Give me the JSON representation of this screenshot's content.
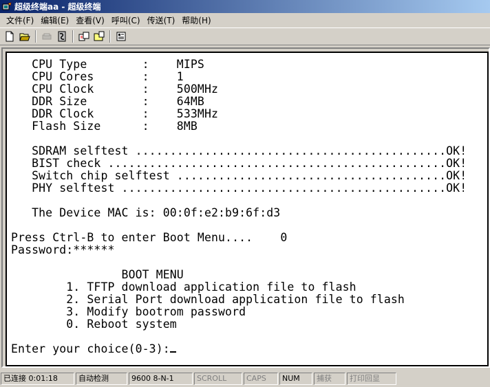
{
  "window": {
    "title": "超级终端aa - 超级终端"
  },
  "menubar": {
    "items": [
      "文件(F)",
      "编辑(E)",
      "查看(V)",
      "呼叫(C)",
      "传送(T)",
      "帮助(H)"
    ]
  },
  "toolbar": {
    "icons": [
      "new-icon",
      "open-icon",
      "disconnect-icon",
      "dial-icon",
      "send-icon",
      "receive-icon",
      "properties-icon"
    ]
  },
  "terminal": {
    "lines": [
      "   CPU Type        :    MIPS",
      "   CPU Cores       :    1",
      "   CPU Clock       :    500MHz",
      "   DDR Size        :    64MB",
      "   DDR Clock       :    533MHz",
      "   Flash Size      :    8MB",
      "",
      "   SDRAM selftest .............................................OK!",
      "   BIST check .................................................OK!",
      "   Switch chip selftest .......................................OK!",
      "   PHY selftest ...............................................OK!",
      "",
      "   The Device MAC is: 00:0f:e2:b9:6f:d3",
      "",
      "Press Ctrl-B to enter Boot Menu....    0",
      "Password:******",
      "",
      "                BOOT MENU",
      "        1. TFTP download application file to flash",
      "        2. Serial Port download application file to flash",
      "        3. Modify bootrom password",
      "        0. Reboot system",
      "",
      "Enter your choice(0-3):"
    ]
  },
  "statusbar": {
    "connected": "已连接 0:01:18",
    "detect": "自动检测",
    "port": "9600 8-N-1",
    "scroll": "SCROLL",
    "caps": "CAPS",
    "num": "NUM",
    "capture": "捕获",
    "print": "打印回显"
  }
}
